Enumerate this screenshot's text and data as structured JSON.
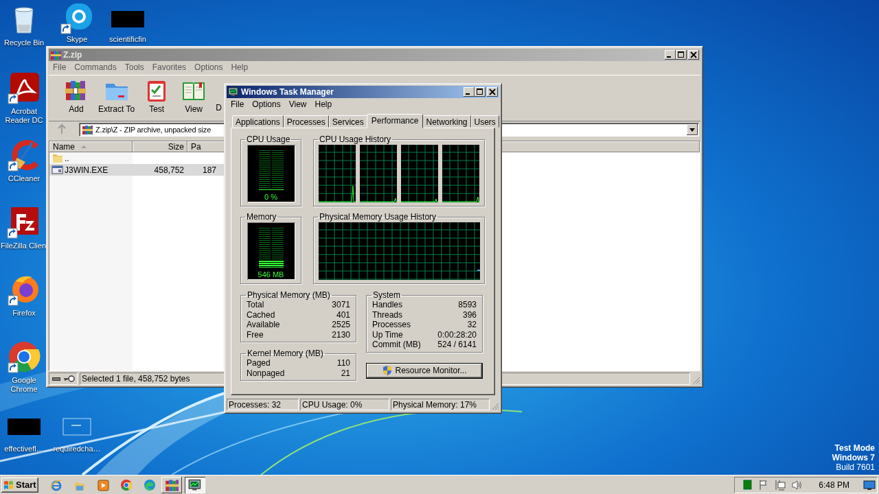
{
  "desktop": {
    "icons": [
      {
        "label": "Recycle Bin",
        "kind": "recycle",
        "shortcut": false
      },
      {
        "label": "Skype",
        "kind": "skype",
        "shortcut": true
      },
      {
        "label": "scientificfin",
        "kind": "redacted",
        "shortcut": false
      },
      {
        "label": "Acrobat Reader DC",
        "kind": "acrobat",
        "shortcut": true
      },
      {
        "label": "CCleaner",
        "kind": "ccleaner",
        "shortcut": true
      },
      {
        "label": "FileZilla Clien",
        "kind": "filezilla",
        "shortcut": true
      },
      {
        "label": "Firefox",
        "kind": "firefox",
        "shortcut": true
      },
      {
        "label": "Google Chrome",
        "kind": "chrome",
        "shortcut": true
      },
      {
        "label": "effectivefl…",
        "kind": "redacted",
        "shortcut": false
      },
      {
        "label": "requiredcha…",
        "kind": "document",
        "shortcut": false
      }
    ],
    "notice": [
      "Test Mode",
      "Windows 7",
      "Build 7601"
    ]
  },
  "archiver": {
    "title": "Z.zip",
    "active": false,
    "menu": [
      "File",
      "Commands",
      "Tools",
      "Favorites",
      "Options",
      "Help"
    ],
    "toolbar": [
      {
        "label": "Add",
        "kind": "add"
      },
      {
        "label": "Extract To",
        "kind": "extract"
      },
      {
        "label": "Test",
        "kind": "test"
      },
      {
        "label": "View",
        "kind": "view"
      },
      {
        "label": "D",
        "kind": "hidden"
      }
    ],
    "address": "Z.zip\\Z - ZIP archive, unpacked size",
    "columns": [
      {
        "label": "Name",
        "sorted": true
      },
      {
        "label": "Size",
        "sorted": false
      },
      {
        "label": "Pa",
        "sorted": false
      }
    ],
    "rows": [
      {
        "kind": "folder",
        "cells": [
          ".."
        ],
        "selected": false
      },
      {
        "kind": "exe",
        "cells": [
          "J3WIN.EXE",
          "458,752",
          "187"
        ],
        "selected": true
      }
    ],
    "status": "Selected 1 file, 458,752 bytes"
  },
  "task_manager": {
    "title": "Windows Task Manager",
    "active": true,
    "menu": [
      "File",
      "Options",
      "View",
      "Help"
    ],
    "tabs": [
      {
        "label": "Applications",
        "selected": false
      },
      {
        "label": "Processes",
        "selected": false
      },
      {
        "label": "Services",
        "selected": false
      },
      {
        "label": "Performance",
        "selected": true
      },
      {
        "label": "Networking",
        "selected": false
      },
      {
        "label": "Users",
        "selected": false
      }
    ],
    "cpu": {
      "title": "CPU Usage",
      "reading": "0 %",
      "level": 0
    },
    "cpu_history": {
      "title": "CPU Usage History"
    },
    "memory": {
      "title": "Memory",
      "reading": "546 MB",
      "level": 0.17
    },
    "memory_history": {
      "title": "Physical Memory Usage History"
    },
    "physical_memory": {
      "title": "Physical Memory (MB)",
      "rows": [
        {
          "label": "Total",
          "value": "3071"
        },
        {
          "label": "Cached",
          "value": "401"
        },
        {
          "label": "Available",
          "value": "2525"
        },
        {
          "label": "Free",
          "value": "2130"
        }
      ]
    },
    "kernel_memory": {
      "title": "Kernel Memory (MB)",
      "rows": [
        {
          "label": "Paged",
          "value": "110"
        },
        {
          "label": "Nonpaged",
          "value": "21"
        }
      ]
    },
    "system": {
      "title": "System",
      "rows": [
        {
          "label": "Handles",
          "value": "8593"
        },
        {
          "label": "Threads",
          "value": "396"
        },
        {
          "label": "Processes",
          "value": "32"
        },
        {
          "label": "Up Time",
          "value": "0:00:28:20"
        },
        {
          "label": "Commit (MB)",
          "value": "524 / 6141"
        }
      ]
    },
    "resource_monitor": "Resource Monitor...",
    "status": [
      "Processes: 32",
      "CPU Usage: 0%",
      "Physical Memory: 17%"
    ]
  },
  "taskbar": {
    "start": "Start",
    "buttons": [
      {
        "kind": "ie",
        "open": false,
        "selected": false
      },
      {
        "kind": "explorer",
        "open": false,
        "selected": false
      },
      {
        "kind": "media",
        "open": false,
        "selected": false
      },
      {
        "kind": "chrome",
        "open": false,
        "selected": false
      },
      {
        "kind": "edge",
        "open": false,
        "selected": false
      },
      {
        "kind": "winrar",
        "open": true,
        "selected": false
      },
      {
        "kind": "taskmgr",
        "open": true,
        "selected": true
      }
    ],
    "tray": [
      {
        "kind": "app"
      },
      {
        "kind": "flag"
      },
      {
        "kind": "network"
      },
      {
        "kind": "volume"
      }
    ],
    "clock": "6:48 PM"
  }
}
